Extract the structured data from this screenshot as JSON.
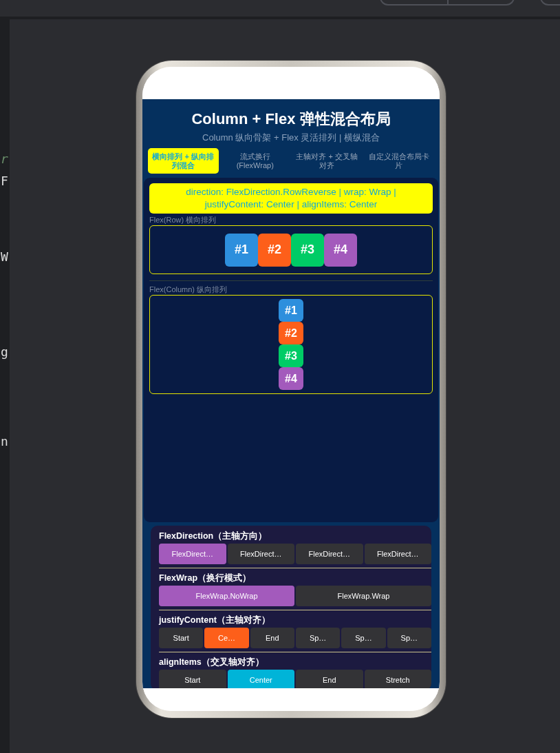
{
  "code_fragments": [
    "r",
    "F",
    "W",
    "g",
    "n"
  ],
  "app": {
    "title": "Column + Flex 弹性混合布局",
    "subtitle": "Column 纵向骨架 + Flex 灵活排列 | 横纵混合",
    "tabs": [
      {
        "label": "横向排列 + 纵向排列混合",
        "selected": true
      },
      {
        "label": "流式换行 (FlexWrap)",
        "selected": false
      },
      {
        "label": "主轴对齐 + 交叉轴对齐",
        "selected": false
      },
      {
        "label": "自定义混合布局卡片",
        "selected": false
      }
    ],
    "config_banner": "direction: FlexDirection.RowReverse | wrap: Wrap | justifyContent: Center | alignItems: Center",
    "row_demo": {
      "label": "Flex(Row) 横向排列",
      "items": [
        {
          "text": "#1",
          "color": "#2d8fdd"
        },
        {
          "text": "#2",
          "color": "#fd5f1a"
        },
        {
          "text": "#3",
          "color": "#00cc66"
        },
        {
          "text": "#4",
          "color": "#a35abc"
        }
      ]
    },
    "column_demo": {
      "label": "Flex(Column) 纵向排列",
      "items": [
        {
          "text": "#1",
          "color": "#2d8fdd"
        },
        {
          "text": "#2",
          "color": "#fd5f1a"
        },
        {
          "text": "#3",
          "color": "#00cc66"
        },
        {
          "text": "#4",
          "color": "#a35abc"
        }
      ]
    },
    "controls": [
      {
        "heading": "FlexDirection（主轴方向）",
        "color": "#a35abc",
        "options": [
          {
            "label": "FlexDirect…",
            "selected": true
          },
          {
            "label": "FlexDirect…",
            "selected": false
          },
          {
            "label": "FlexDirect…",
            "selected": false
          },
          {
            "label": "FlexDirect…",
            "selected": false
          }
        ]
      },
      {
        "heading": "FlexWrap（换行模式）",
        "color": "#a35abc",
        "options": [
          {
            "label": "FlexWrap.NoWrap",
            "selected": true
          },
          {
            "label": "FlexWrap.Wrap",
            "selected": false
          }
        ]
      },
      {
        "heading": "justifyContent（主轴对齐）",
        "color": "#fd5f1a",
        "options": [
          {
            "label": "Start",
            "selected": false
          },
          {
            "label": "Ce…",
            "selected": true
          },
          {
            "label": "End",
            "selected": false
          },
          {
            "label": "Sp…",
            "selected": false
          },
          {
            "label": "Sp…",
            "selected": false
          },
          {
            "label": "Sp…",
            "selected": false
          }
        ]
      },
      {
        "heading": "alignItems（交叉轴对齐）",
        "color": "#00b4d8",
        "options": [
          {
            "label": "Start",
            "selected": false
          },
          {
            "label": "Center",
            "selected": true
          },
          {
            "label": "End",
            "selected": false
          },
          {
            "label": "Stretch",
            "selected": false
          }
        ]
      }
    ]
  }
}
